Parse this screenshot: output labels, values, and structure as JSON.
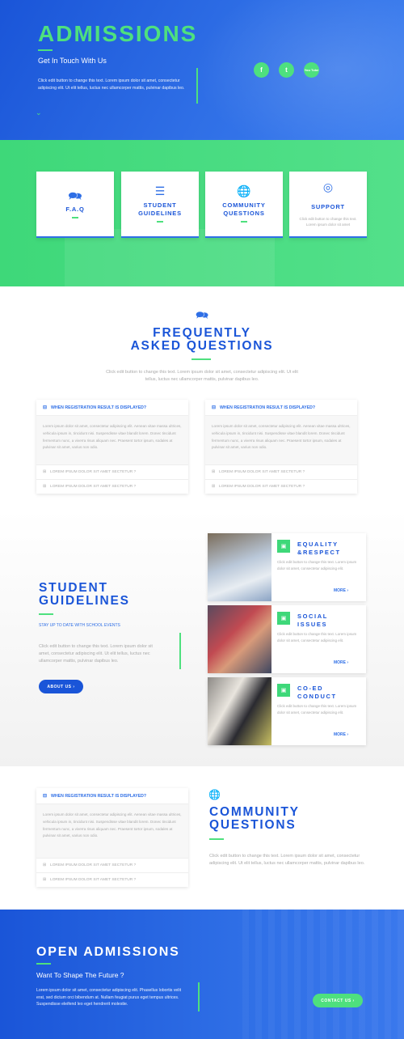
{
  "hero": {
    "title": "ADMISSIONS",
    "subtitle": "Get In Touch With Us",
    "text": "Click edit button to change this text. Lorem ipsum dolor sit amet, consectetur adipiscing elit. Ut elit tellus, luctus nec ullamcorper mattis, pulvinar dapibus leo.",
    "social": [
      "f",
      "t",
      "You Tube"
    ]
  },
  "cards": [
    {
      "label": "F.A.Q",
      "icon": "chat-bubbles-icon",
      "desc": ""
    },
    {
      "label": "STUDENT GUIDELINES",
      "icon": "signpost-icon",
      "desc": ""
    },
    {
      "label": "COMMUNITY QUESTIONS",
      "icon": "globe-icon",
      "desc": ""
    },
    {
      "label": "SUPPORT",
      "icon": "lifebuoy-icon",
      "desc": "Click edit button to change this text. Lorem ipsum dolor sit amet"
    }
  ],
  "faq": {
    "heading_1": "FREQUENTLY",
    "heading_2": "ASKED QUESTIONS",
    "text": "Click edit button to change this text. Lorem ipsum dolor sit amet, consectetur adipiscing elit. Ut elit tellus, luctus nec ullamcorper mattis, pulvinar dapibus leo.",
    "question": "WHEN REGISTRATION RESULT IS DISPLAYED?",
    "answer": "Lorem ipsum dolor sit amet, consectetur adipiscing elit. Aenean vitae massa ultrices, vehicula ipsum in, tincidunt nisi. Suspendisse vitae blandit lorem. Donec tincidunt fermentum nunc, a viverra risus aliquam nec. Praesent tortor ipsum, sodales at pulvinar sit amet, varius non odio.",
    "row": "LOREM IPSUM DOLOR SIT AMET SECTETUR ?"
  },
  "guidelines": {
    "heading_1": "STUDENT",
    "heading_2": "GUIDELINES",
    "tagline": "STAY UP TO DATE WITH SCHOOL EVENTS",
    "text": "Click edit button to change this text. Lorem ipsum dolor sit amet, consectetur adipiscing elit. Ut elit tellus, luctus nec ullamcorper mattis, pulvinar dapibus leo.",
    "button": "ABOUT US ›",
    "items": [
      {
        "title_1": "EQUALITY",
        "title_2": "&RESPECT",
        "desc": "Click edit button to change this text. Lorem ipsum dolor sit amet, consectetur adipiscing elit.",
        "more": "MORE ›"
      },
      {
        "title_1": "SOCIAL",
        "title_2": "ISSUES",
        "desc": "Click edit button to change this text. Lorem ipsum dolor sit amet, consectetur adipiscing elit.",
        "more": "MORE ›"
      },
      {
        "title_1": "CO-ED",
        "title_2": "CONDUCT",
        "desc": "Click edit button to change this text. Lorem ipsum dolor sit amet, consectetur adipiscing elit.",
        "more": "MORE ›"
      }
    ]
  },
  "community": {
    "heading_1": "COMMUNITY",
    "heading_2": "QUESTIONS",
    "text": "Click edit button to change this text. Lorem ipsum dolor sit amet, consectetur adipiscing elit. Ut elit tellus, luctus nec ullamcorper mattis, pulvinar dapibus leo."
  },
  "open": {
    "title": "OPEN ADMISSIONS",
    "subtitle": "Want To Shape The Future ?",
    "text": "Lorem ipsum dolor sit amet, consectetur adipiscing elit. Phasellus lobortis velit erat, sed dictum orci bibendum at. Nullam feugiat purus eget tempus ultrices. Suspendisse eleifend leo eget hendrerit molestie.",
    "button": "CONTACT US ›"
  },
  "colors": {
    "blue": "#1a55d8",
    "green": "#4ee07e"
  }
}
